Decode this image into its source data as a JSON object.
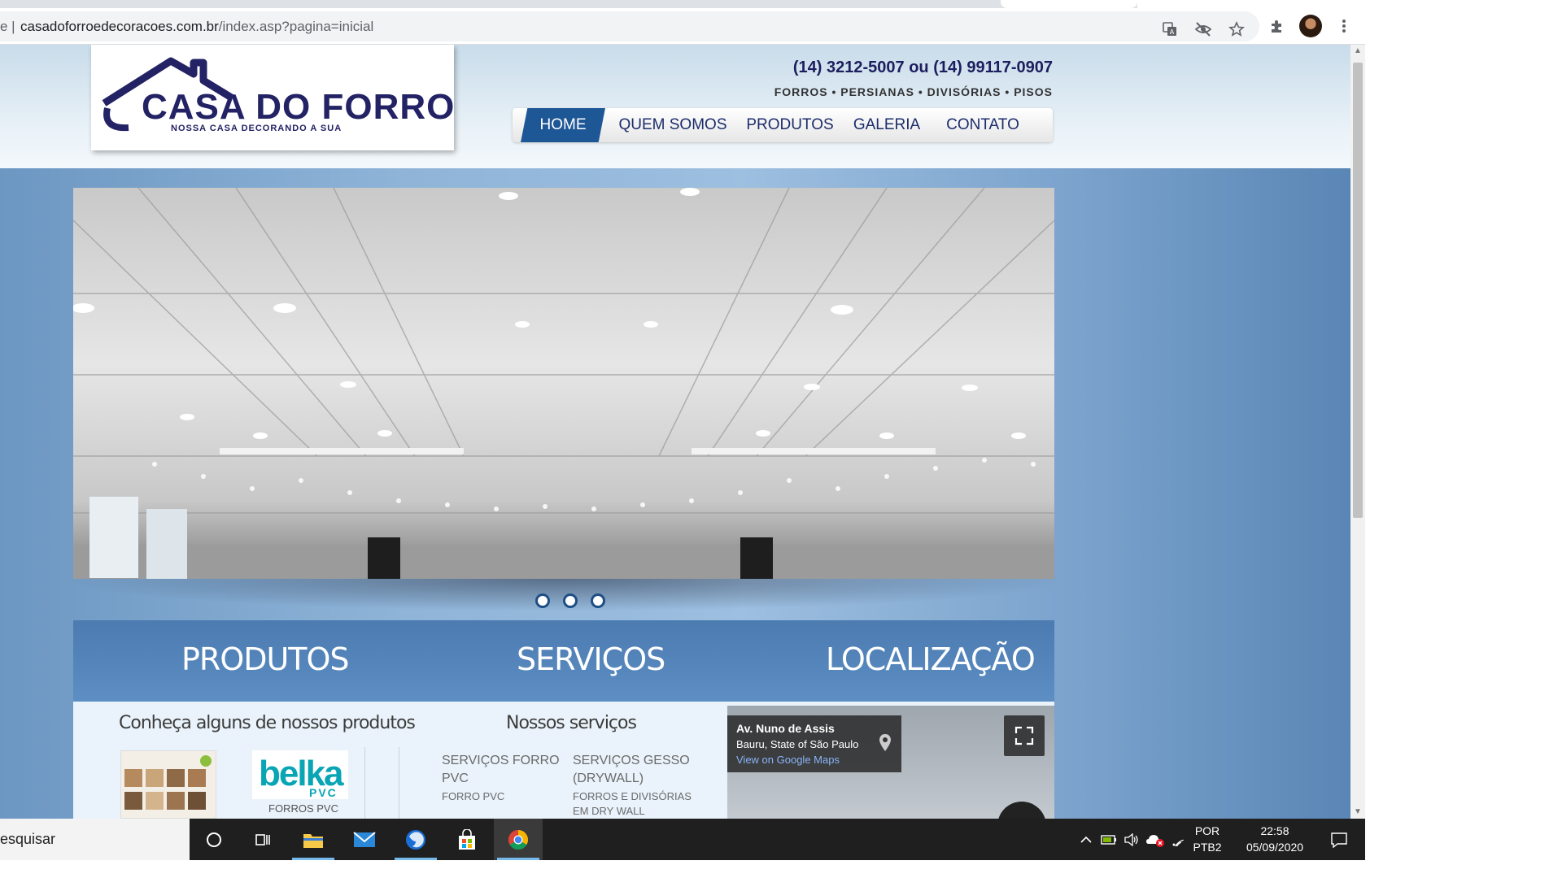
{
  "browser": {
    "url_prefix": "e |",
    "url_host": "casadoforroedecoracoes.com.br",
    "url_path": "/index.asp?pagina=inicial",
    "icons": [
      "translate-icon",
      "eye-off-icon",
      "star-icon",
      "puzzle-icon",
      "avatar",
      "more-vert-icon"
    ]
  },
  "site": {
    "logo_main": "CASA DO FORRO",
    "logo_tagline": "NOSSA CASA DECORANDO A SUA",
    "phone": "(14) 3212-5007 ou (14) 99117-0907",
    "services_line": "FORROS • PERSIANAS • DIVISÓRIAS • PISOS",
    "nav": {
      "home": "HOME",
      "quem_somos": "QUEM SOMOS",
      "produtos": "PRODUTOS",
      "galeria": "GALERIA",
      "contato": "CONTATO"
    },
    "slider_dots": 3,
    "sections": {
      "produtos": "PRODUTOS",
      "servicos": "SERVIÇOS",
      "localizacao": "LOCALIZAÇÃO"
    },
    "produtos_head": "Conheça alguns de nossos produtos",
    "brand_logo": "belka",
    "brand_logo_sub": "PVC",
    "produto_label": "FORROS PVC",
    "servicos_head": "Nossos serviços",
    "svc1_title_1": "SERVIÇOS FORRO",
    "svc1_title_2": "PVC",
    "svc1_sub": "FORRO PVC",
    "svc2_title_1": "SERVIÇOS GESSO",
    "svc2_title_2": "(DRYWALL)",
    "svc2_sub_1": "FORROS E DIVISÓRIAS",
    "svc2_sub_2": "EM DRY WALL",
    "map": {
      "address": "Av. Nuno de Assis",
      "city": "Bauru, State of São Paulo",
      "link": "View on Google Maps"
    }
  },
  "taskbar": {
    "search_text": "esquisar",
    "apps": [
      "cortana-icon",
      "task-view-icon",
      "file-explorer-icon",
      "mail-icon",
      "firefox-icon",
      "store-icon",
      "chrome-icon"
    ],
    "lang_1": "POR",
    "lang_2": "PTB2",
    "time": "22:58",
    "date": "05/09/2020"
  }
}
